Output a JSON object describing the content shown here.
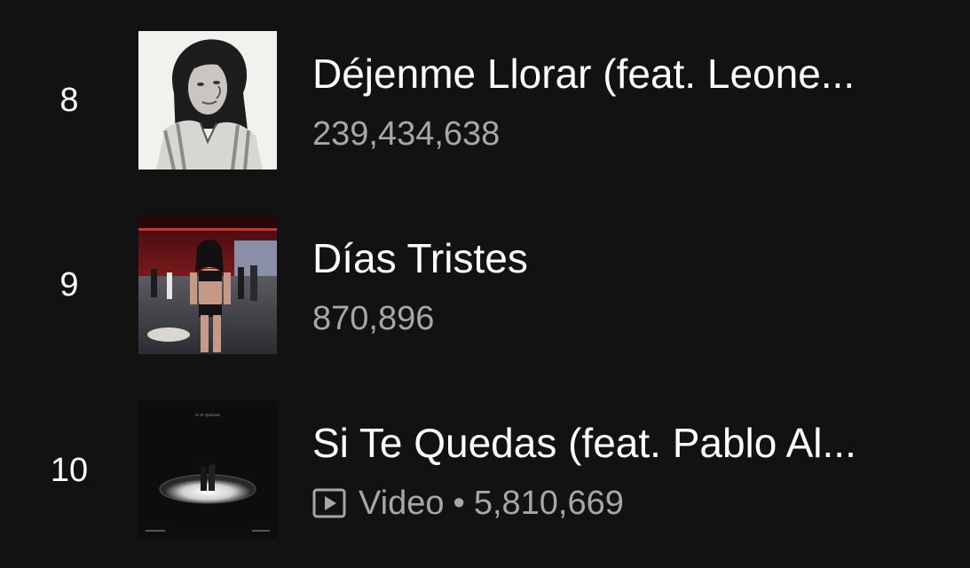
{
  "tracks": [
    {
      "index": "8",
      "title": "Déjenme Llorar (feat. Leone...",
      "plays": "239,434,638",
      "cover_icon": "album-cover-portrait-bw"
    },
    {
      "index": "9",
      "title": "Días Tristes",
      "plays": "870,896",
      "cover_icon": "album-cover-red-room"
    },
    {
      "index": "10",
      "title": "Si Te Quedas (feat. Pablo Al...",
      "video_label": "Video",
      "separator": "•",
      "plays": "5,810,669",
      "cover_icon": "album-cover-spotlight-stage",
      "cover_text": "SI TE QUEDAS"
    }
  ],
  "icons": {
    "video": "video-play-icon"
  },
  "colors": {
    "background": "#121212",
    "primary_text": "#ffffff",
    "secondary_text": "#a7a7a7"
  }
}
